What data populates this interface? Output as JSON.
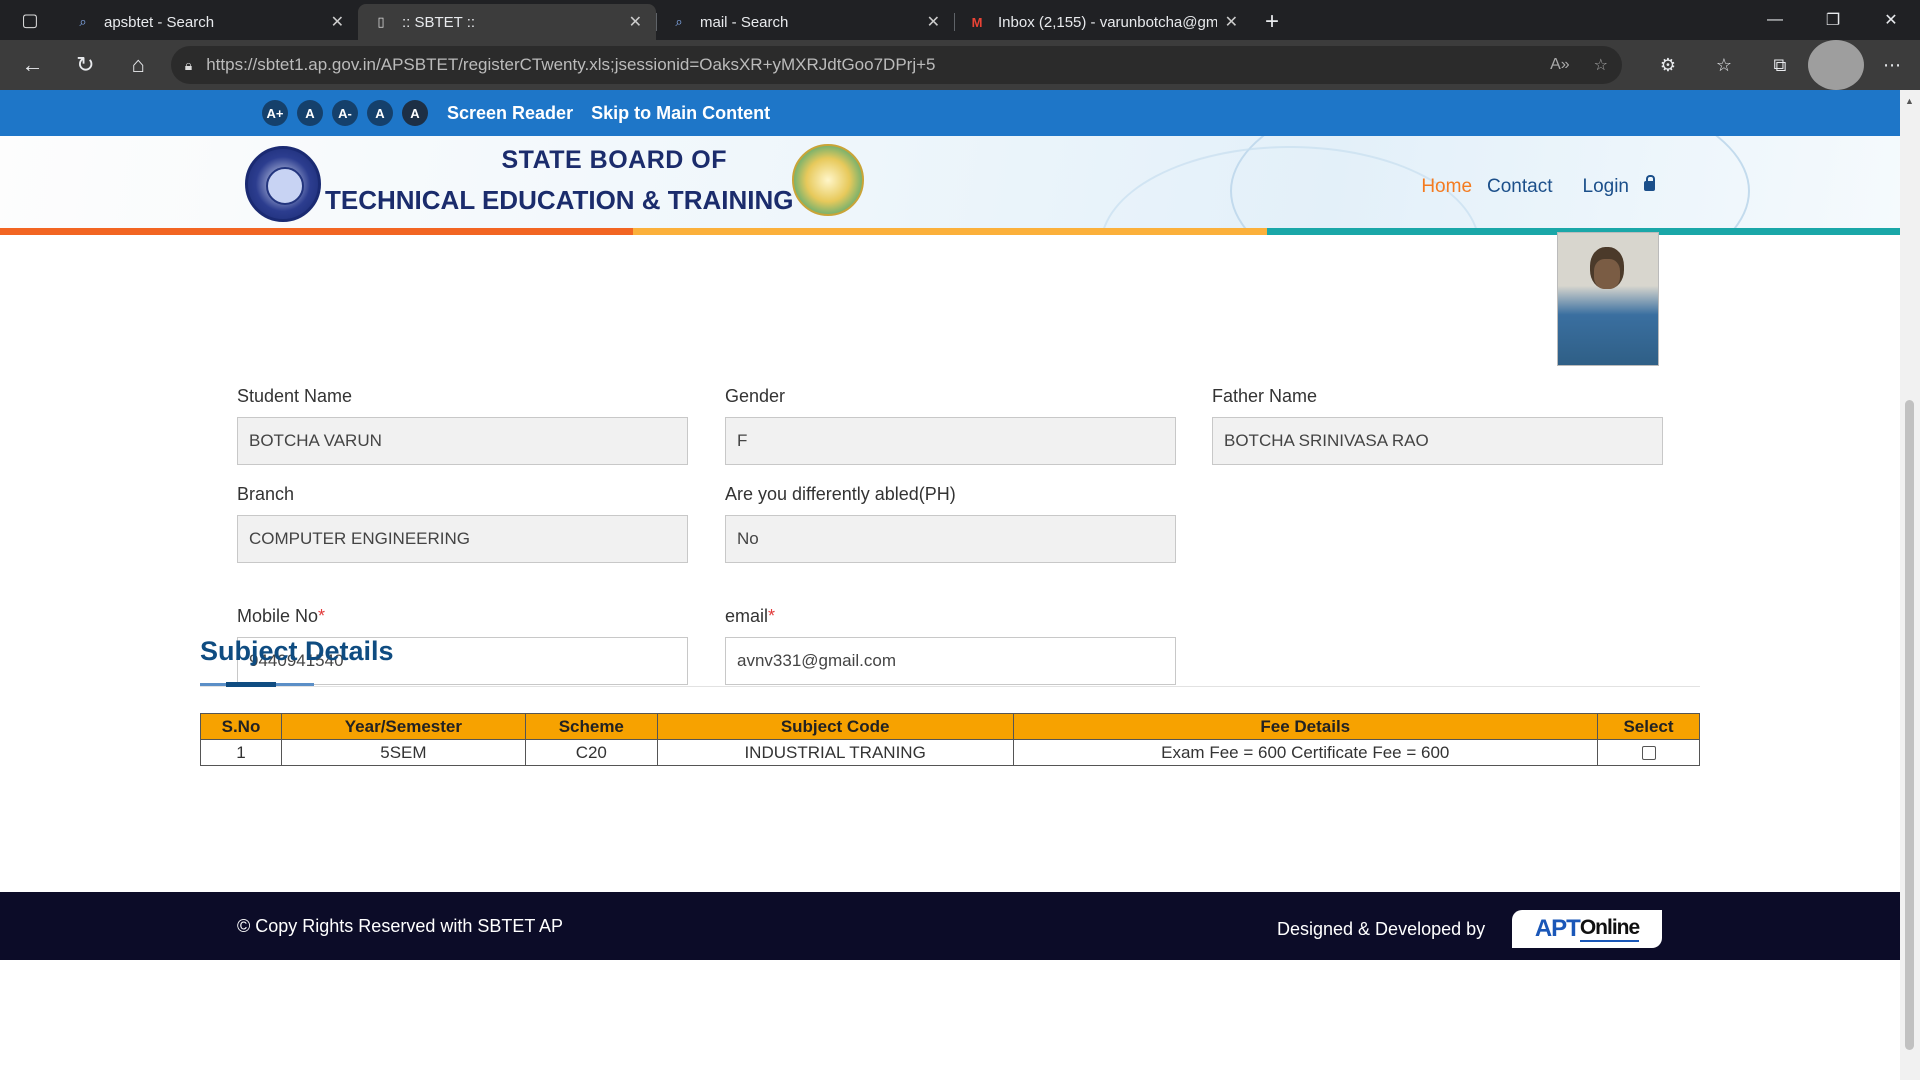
{
  "browser": {
    "tabs": [
      {
        "title": "apsbtet - Search",
        "icon": "search-icon"
      },
      {
        "title": ":: SBTET ::",
        "icon": "page-icon",
        "active": true
      },
      {
        "title": "mail - Search",
        "icon": "search-icon"
      },
      {
        "title": "Inbox (2,155) - varunbotcha@gm",
        "icon": "gmail-icon"
      }
    ],
    "url": "https://sbtet1.ap.gov.in/APSBTET/registerCTwenty.xls;jsessionid=OaksXR+yMXRJdtGoo7DPrj+5"
  },
  "accessibility": {
    "font_buttons": [
      "A+",
      "A",
      "A-",
      "A",
      "A"
    ],
    "screen_reader": "Screen Reader",
    "skip": "Skip to Main Content"
  },
  "header": {
    "title_line1": "STATE BOARD OF",
    "title_line2": "TECHNICAL EDUCATION & TRAINING",
    "nav": {
      "home": "Home",
      "contact": "Contact",
      "login": "Login"
    }
  },
  "form": {
    "student_name": {
      "label": "Student Name",
      "value": "BOTCHA VARUN"
    },
    "gender": {
      "label": "Gender",
      "value": "F"
    },
    "father_name": {
      "label": "Father Name",
      "value": "BOTCHA SRINIVASA RAO"
    },
    "branch": {
      "label": "Branch",
      "value": "COMPUTER ENGINEERING"
    },
    "ph": {
      "label": "Are you differently abled(PH)",
      "value": "No"
    },
    "mobile": {
      "label": "Mobile No",
      "required_mark": "*",
      "value": "9440941540"
    },
    "email": {
      "label": "email",
      "required_mark": "*",
      "value": "avnv331@gmail.com"
    }
  },
  "subjects": {
    "title": "Subject Details",
    "headers": [
      "S.No",
      "Year/Semester",
      "Scheme",
      "Subject Code",
      "Fee Details",
      "Select"
    ],
    "rows": [
      {
        "sno": "1",
        "semester": "5SEM",
        "scheme": "C20",
        "subject": "INDUSTRIAL TRANING",
        "fee": "Exam Fee = 600 Certificate Fee = 600",
        "selected": false
      }
    ]
  },
  "footer": {
    "copyright": "© Copy Rights Reserved with SBTET AP",
    "designed_by": "Designed & Developed by",
    "logo_text_a": "APT",
    "logo_text_b": "Online"
  },
  "colors": {
    "access_bar": "#1e76c8",
    "table_header": "#f7a200",
    "strip": [
      "#f26522",
      "#fbb03b",
      "#1aa7a8"
    ],
    "footer": "#0c0c28",
    "section_title": "#0f4c81"
  }
}
